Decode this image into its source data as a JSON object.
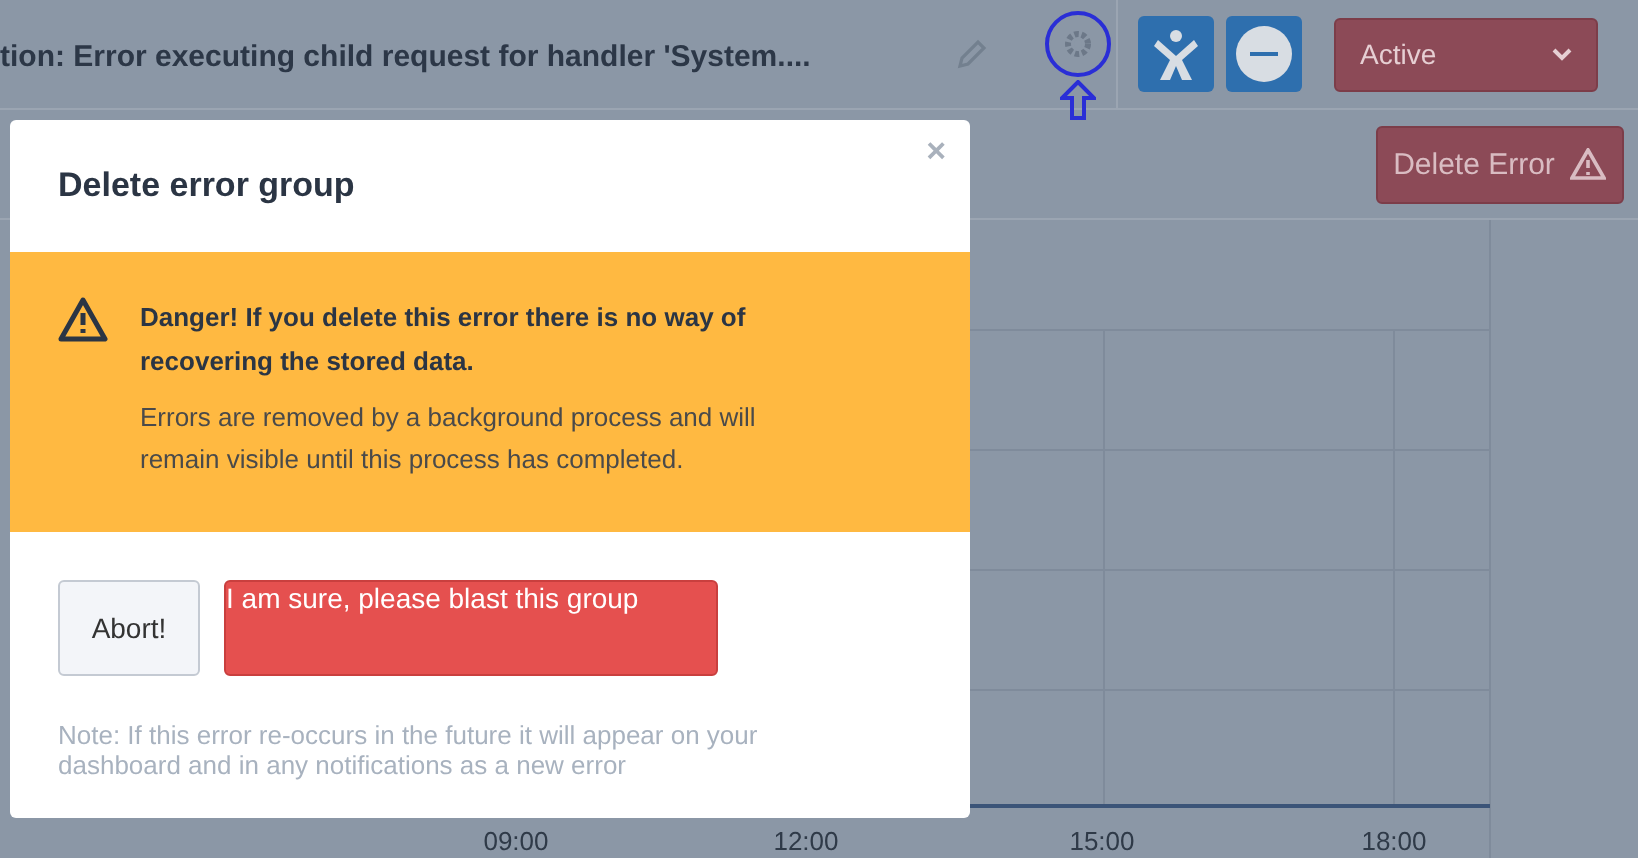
{
  "header": {
    "title": "tion: Error executing child request for handler 'System....",
    "status": "Active"
  },
  "toolbar": {
    "delete_button": "Delete Error"
  },
  "chart": {
    "x_labels": [
      "09:00",
      "12:00",
      "15:00",
      "18:00"
    ]
  },
  "modal": {
    "title": "Delete error group",
    "close": "×",
    "danger": {
      "heading": "Danger! If you delete this error there is no way of recovering the stored data.",
      "body": "Errors are removed by a background process and will remain visible until this process has completed."
    },
    "buttons": [
      {
        "label": "Abort!",
        "kind": "default"
      },
      {
        "label": "I am sure, please blast this group",
        "kind": "danger"
      }
    ],
    "note": "Note: If this error re-occurs in the future it will appear on your dashboard and in any notifications as a new error"
  }
}
